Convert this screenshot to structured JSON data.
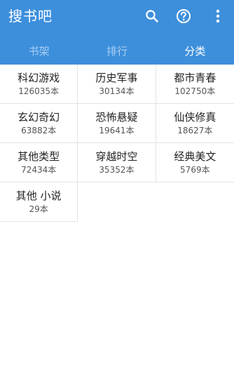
{
  "app": {
    "title": "搜书吧"
  },
  "actions": [
    {
      "icon": "search-icon"
    },
    {
      "icon": "help-icon"
    },
    {
      "icon": "more-vert-icon"
    }
  ],
  "tabs": [
    {
      "label": "书架",
      "active": false
    },
    {
      "label": "排行",
      "active": false
    },
    {
      "label": "分类",
      "active": true
    }
  ],
  "colors": {
    "appbar": "#3d8fdc",
    "tab_inactive": "#a9cff2",
    "tab_active": "#ffffff"
  },
  "categories": [
    {
      "name": "科幻游戏",
      "count": "126035本"
    },
    {
      "name": "历史军事",
      "count": "30134本"
    },
    {
      "name": "都市青春",
      "count": "102750本"
    },
    {
      "name": "玄幻奇幻",
      "count": "63882本"
    },
    {
      "name": "恐怖悬疑",
      "count": "19641本"
    },
    {
      "name": "仙侠修真",
      "count": "18627本"
    },
    {
      "name": "其他类型",
      "count": "72434本"
    },
    {
      "name": "穿越时空",
      "count": "35352本"
    },
    {
      "name": "经典美文",
      "count": "5769本"
    },
    {
      "name": "其他 小说",
      "count": "29本"
    }
  ]
}
